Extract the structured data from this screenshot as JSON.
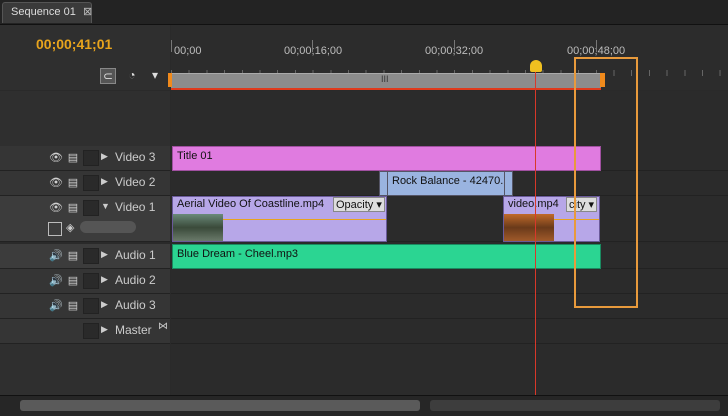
{
  "tab": {
    "label": "Sequence 01",
    "close": "⊠"
  },
  "timecode": "00;00;41;01",
  "ruler": {
    "ticks": [
      "00;00",
      "00;00;16;00",
      "00;00;32;00",
      "00;00;48;00"
    ],
    "grip": "III"
  },
  "tracks": {
    "video3": {
      "name": "Video 3"
    },
    "video2": {
      "name": "Video 2"
    },
    "video1": {
      "name": "Video 1"
    },
    "audio1": {
      "name": "Audio 1"
    },
    "audio2": {
      "name": "Audio 2"
    },
    "audio3": {
      "name": "Audio 3"
    },
    "master": {
      "name": "Master"
    }
  },
  "clips": {
    "title01": "Title 01",
    "rock_balance": "Rock Balance - 42470.",
    "aerial": "Aerial Video Of Coastline.mp4",
    "aerial_fx": "Opacity ▾",
    "video_mp4": "video.mp4",
    "video_mp4_fx": "city ▾",
    "blue_dream": "Blue Dream - Cheel.mp3"
  },
  "colors": {
    "title_clip": "#e07be0",
    "video_clip": "#b7a7e8",
    "rock_clip": "#9ab4e0",
    "audio_clip": "#2bd592",
    "timecode": "#e8a41d",
    "playhead": "#d8382a",
    "highlight": "#e89a3c"
  },
  "icons": {
    "eye": "👁",
    "film": "▤",
    "speaker": "🔊",
    "expand": "▶",
    "collapse": "▼"
  }
}
